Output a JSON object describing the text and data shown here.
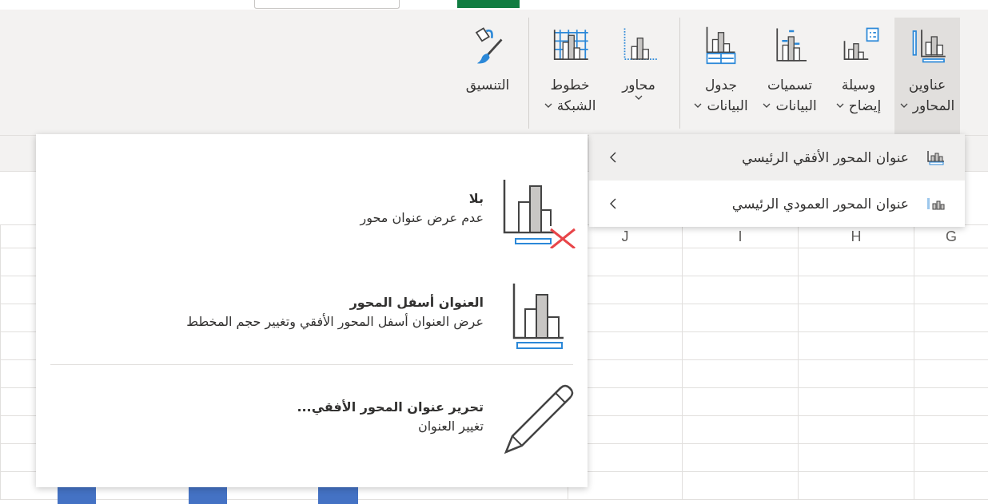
{
  "ribbon": {
    "groups": [
      {
        "buttons": [
          {
            "lines": [
              "عناوين",
              "المحاور"
            ],
            "kind": "axis-titles",
            "dropdown": true,
            "selected": true
          },
          {
            "lines": [
              "وسيلة",
              "إيضاح"
            ],
            "kind": "legend",
            "dropdown": true,
            "selected": false
          },
          {
            "lines": [
              "تسميات",
              "البيانات"
            ],
            "kind": "data-labels",
            "dropdown": true,
            "selected": false
          },
          {
            "lines": [
              "جدول",
              "البيانات"
            ],
            "kind": "data-table",
            "dropdown": true,
            "selected": false
          }
        ]
      },
      {
        "buttons": [
          {
            "lines": [
              "محاور"
            ],
            "kind": "axes",
            "dropdown": true,
            "selected": false
          },
          {
            "lines": [
              "خطوط",
              "الشبكة"
            ],
            "kind": "gridlines",
            "dropdown": true,
            "selected": false
          }
        ]
      },
      {
        "buttons": [
          {
            "lines": [
              "التنسيق"
            ],
            "kind": "format",
            "dropdown": false,
            "selected": false
          }
        ]
      }
    ]
  },
  "submenu": {
    "items": [
      {
        "label": "عنوان المحور الأفقي الرئيسي",
        "kind": "horizontal",
        "selected": true
      },
      {
        "label": "عنوان المحور العمودي الرئيسي",
        "kind": "vertical",
        "selected": false
      }
    ]
  },
  "options": {
    "items": [
      {
        "title": "بلا",
        "description": "عدم عرض عنوان محور",
        "kind": "none"
      },
      {
        "title": "العنوان أسفل المحور",
        "description": "عرض العنوان أسفل المحور الأفقي وتغيير حجم المخطط",
        "kind": "below"
      },
      {
        "title": "تحرير عنوان المحور الأفقي...",
        "description": "تغيير العنوان",
        "kind": "edit"
      }
    ]
  },
  "sheet": {
    "column_headers": [
      "G",
      "H",
      "I",
      "J"
    ]
  }
}
